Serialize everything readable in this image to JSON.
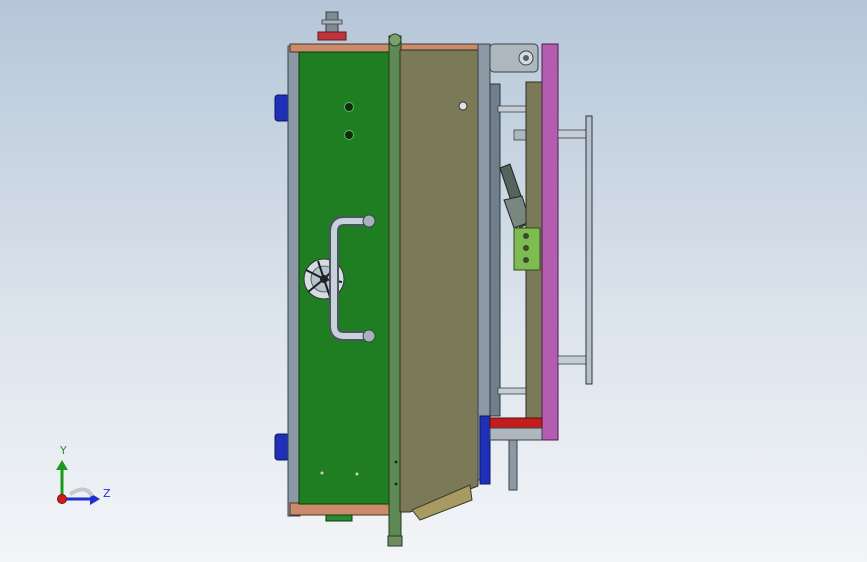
{
  "viewport": {
    "background_top": "#b6c6d8",
    "background_bottom": "#f3f5f8"
  },
  "model": {
    "colors": {
      "green_plate": "#1f7d22",
      "olive_body": "#7a7a59",
      "olive_dark": "#5d5d42",
      "steel": "#8c98a4",
      "steel_dark": "#55606b",
      "pink_plate": "#b45cb0",
      "tan_plate": "#a79a62",
      "copper": "#c98b6a",
      "blue_clamp": "#1e30b8",
      "red_rail": "#c41d1d",
      "light_green_block": "#7ebc52"
    }
  },
  "triad": {
    "y_label": "Y",
    "z_label": "Z",
    "y_color": "#1a9a1a",
    "z_color": "#1f2fd0",
    "x_color": "#d01c1c"
  }
}
